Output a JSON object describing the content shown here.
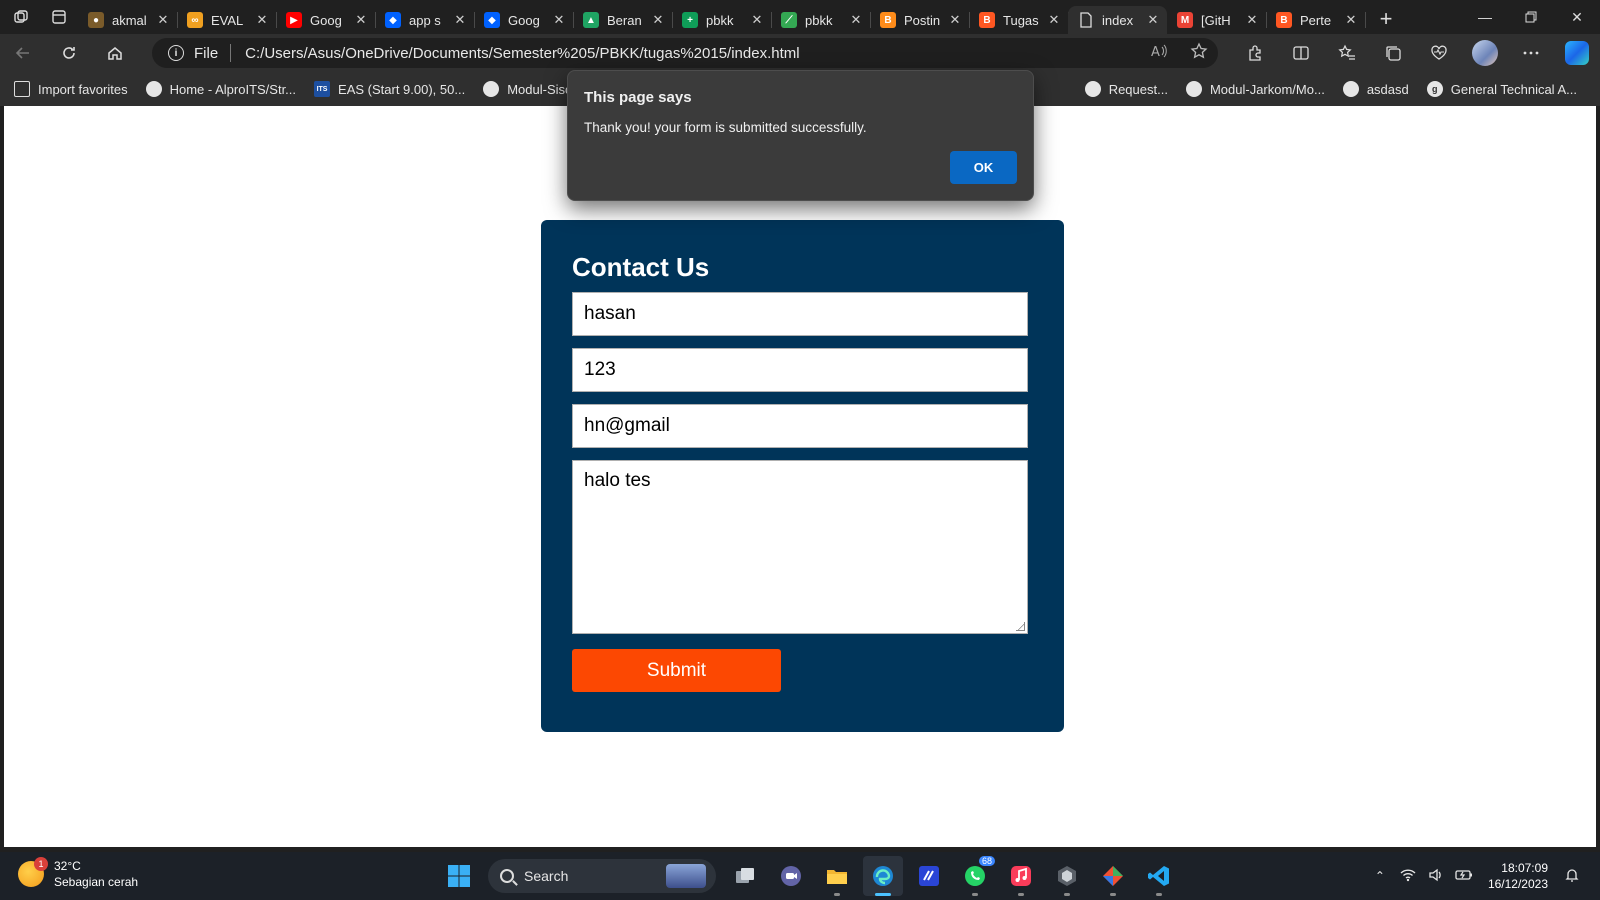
{
  "browser": {
    "tabs": [
      {
        "title": "akmal",
        "icon": "user-icon",
        "color": "#7a5b2a"
      },
      {
        "title": "EVAL",
        "icon": "infinity-icon",
        "color": "#f0a020"
      },
      {
        "title": "Goog",
        "icon": "youtube-icon",
        "color": "#ff0000"
      },
      {
        "title": "app s",
        "icon": "dropbox-icon",
        "color": "#0061fe"
      },
      {
        "title": "Goog",
        "icon": "dropbox-icon",
        "color": "#0061fe"
      },
      {
        "title": "Beran",
        "icon": "drive-icon",
        "color": "#1fa463"
      },
      {
        "title": "pbkk",
        "icon": "sheets-icon",
        "color": "#0f9d58"
      },
      {
        "title": "pbkk",
        "icon": "chart-icon",
        "color": "#34a853"
      },
      {
        "title": "Postin",
        "icon": "blogger-icon",
        "color": "#ff8c1a"
      },
      {
        "title": "Tugas",
        "icon": "blogger-icon",
        "color": "#ff5722"
      },
      {
        "title": "index",
        "icon": "file-icon",
        "color": "#d8d8d8",
        "active": true
      },
      {
        "title": "[GitH",
        "icon": "gmail-icon",
        "color": "#ea4335"
      },
      {
        "title": "Perte",
        "icon": "blogger-icon",
        "color": "#ff5722"
      }
    ],
    "address": {
      "scheme": "File",
      "url": "C:/Users/Asus/OneDrive/Documents/Semester%205/PBKK/tugas%2015/index.html"
    },
    "favorites": [
      {
        "label": "Import favorites",
        "icon": "import-icon"
      },
      {
        "label": "Home - AlproITS/Str...",
        "icon": "github-icon"
      },
      {
        "label": "EAS (Start 9.00), 50...",
        "icon": "its-icon"
      },
      {
        "label": "Modul-Sisop/I",
        "icon": "github-icon"
      },
      {
        "label": "Request...",
        "icon": "github-icon"
      },
      {
        "label": "Modul-Jarkom/Mo...",
        "icon": "github-icon"
      },
      {
        "label": "asdasd",
        "icon": "github-icon"
      },
      {
        "label": "General Technical A...",
        "icon": "g-icon"
      }
    ]
  },
  "dialog": {
    "title": "This page says",
    "message": "Thank you! your form is submitted successfully.",
    "ok_label": "OK"
  },
  "form": {
    "heading": "Contact Us",
    "name_value": "hasan",
    "phone_value": "123",
    "email_value": "hn@gmail",
    "message_value": "halo tes",
    "submit_label": "Submit",
    "card_color": "#003459",
    "button_color": "#fc4802"
  },
  "taskbar": {
    "weather_temp": "32°C",
    "weather_desc": "Sebagian cerah",
    "weather_badge": "1",
    "search_label": "Search",
    "whatsapp_badge": "68",
    "time": "18:07:09",
    "date": "16/12/2023"
  }
}
